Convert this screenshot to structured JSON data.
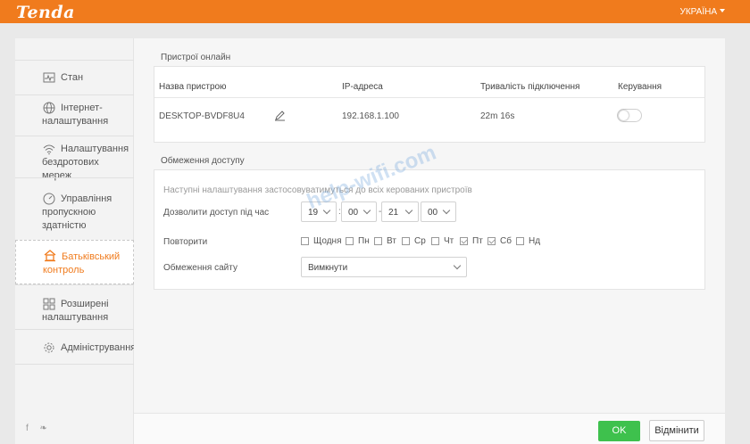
{
  "header": {
    "logo": "Tenda",
    "language": "УКРАЇНА"
  },
  "sidebar": {
    "items": [
      {
        "label": "Стан",
        "icon": "pulse-icon",
        "active": false
      },
      {
        "label": "Інтернет-налаштування",
        "icon": "globe-icon",
        "active": false
      },
      {
        "label": "Налаштування бездротових мереж",
        "icon": "wifi-icon",
        "active": false
      },
      {
        "label": "Управління пропускною здатністю",
        "icon": "gauge-icon",
        "active": false
      },
      {
        "label": "Батьківський контроль",
        "icon": "house-icon",
        "active": true
      },
      {
        "label": "Розширені налаштування",
        "icon": "grid-icon",
        "active": false
      },
      {
        "label": "Адміністрування",
        "icon": "gear-icon",
        "active": false
      }
    ],
    "social": "f  ❧"
  },
  "online": {
    "title": "Пристрої онлайн",
    "columns": [
      "Назва пристрою",
      "IP-адреса",
      "Тривалість підключення",
      "Керування"
    ],
    "rows": [
      {
        "name": "DESKTOP-BVDF8U4",
        "ip": "192.168.1.100",
        "duration": "22m 16s",
        "control": false
      }
    ]
  },
  "restriction": {
    "title": "Обмеження доступу",
    "note": "Наступні налаштування застосовуватимуться до всіх керованих пристроїв",
    "time_label": "Дозволити доступ під час",
    "start_hour": "19",
    "start_min": "00",
    "end_hour": "21",
    "end_min": "00",
    "time_sep": ":",
    "range_sep": "-",
    "repeat_label": "Повторити",
    "days": [
      {
        "label": "Щодня",
        "checked": false
      },
      {
        "label": "Пн",
        "checked": false
      },
      {
        "label": "Вт",
        "checked": false
      },
      {
        "label": "Ср",
        "checked": false
      },
      {
        "label": "Чт",
        "checked": false
      },
      {
        "label": "Пт",
        "checked": true
      },
      {
        "label": "Сб",
        "checked": true
      },
      {
        "label": "Нд",
        "checked": false
      }
    ],
    "site_label": "Обмеження сайту",
    "site_value": "Вимкнути"
  },
  "footer": {
    "ok_label": "OK",
    "cancel_label": "Відмінити"
  },
  "watermark": "help-wifi.com",
  "colors": {
    "brand": "#f07b1d",
    "ok": "#3ec14d"
  }
}
